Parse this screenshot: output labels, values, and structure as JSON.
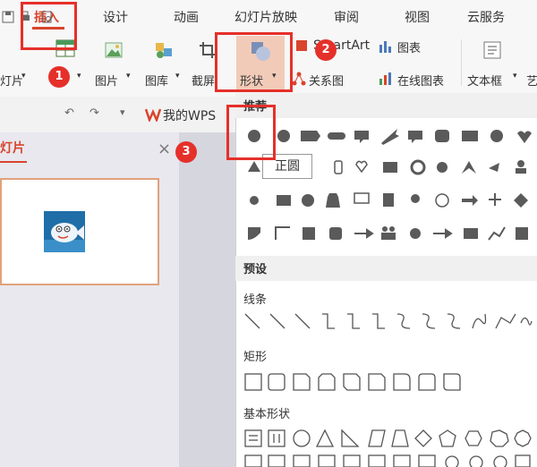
{
  "tabs": [
    {
      "label": "插入",
      "active": true
    },
    {
      "label": "设计"
    },
    {
      "label": "动画"
    },
    {
      "label": "幻灯片放映"
    },
    {
      "label": "审阅"
    },
    {
      "label": "视图"
    },
    {
      "label": "云服务"
    }
  ],
  "ribbon": {
    "left_partial": "灯片",
    "picture": "图片",
    "gallery": "图库",
    "screenshot": "截屏",
    "shape": "形状",
    "smartart": "SmartArt",
    "relation": "关系图",
    "chart": "图表",
    "online_chart": "在线图表",
    "textbox": "文本框",
    "art_partial": "艺"
  },
  "qat": {
    "mywps": "我的WPS"
  },
  "left_panel": {
    "title": "灯片",
    "close": "×"
  },
  "dropdown": {
    "recommended": "推荐",
    "presets": "预设",
    "lines": "线条",
    "rectangles": "矩形",
    "basic_shapes": "基本形状"
  },
  "tooltip": "正圆",
  "annotations": {
    "step1": "1",
    "step2": "2",
    "step3": "3"
  },
  "colors": {
    "accent": "#d9442c",
    "annotation": "#e5302a",
    "shape_fill": "#5a5a5a"
  }
}
